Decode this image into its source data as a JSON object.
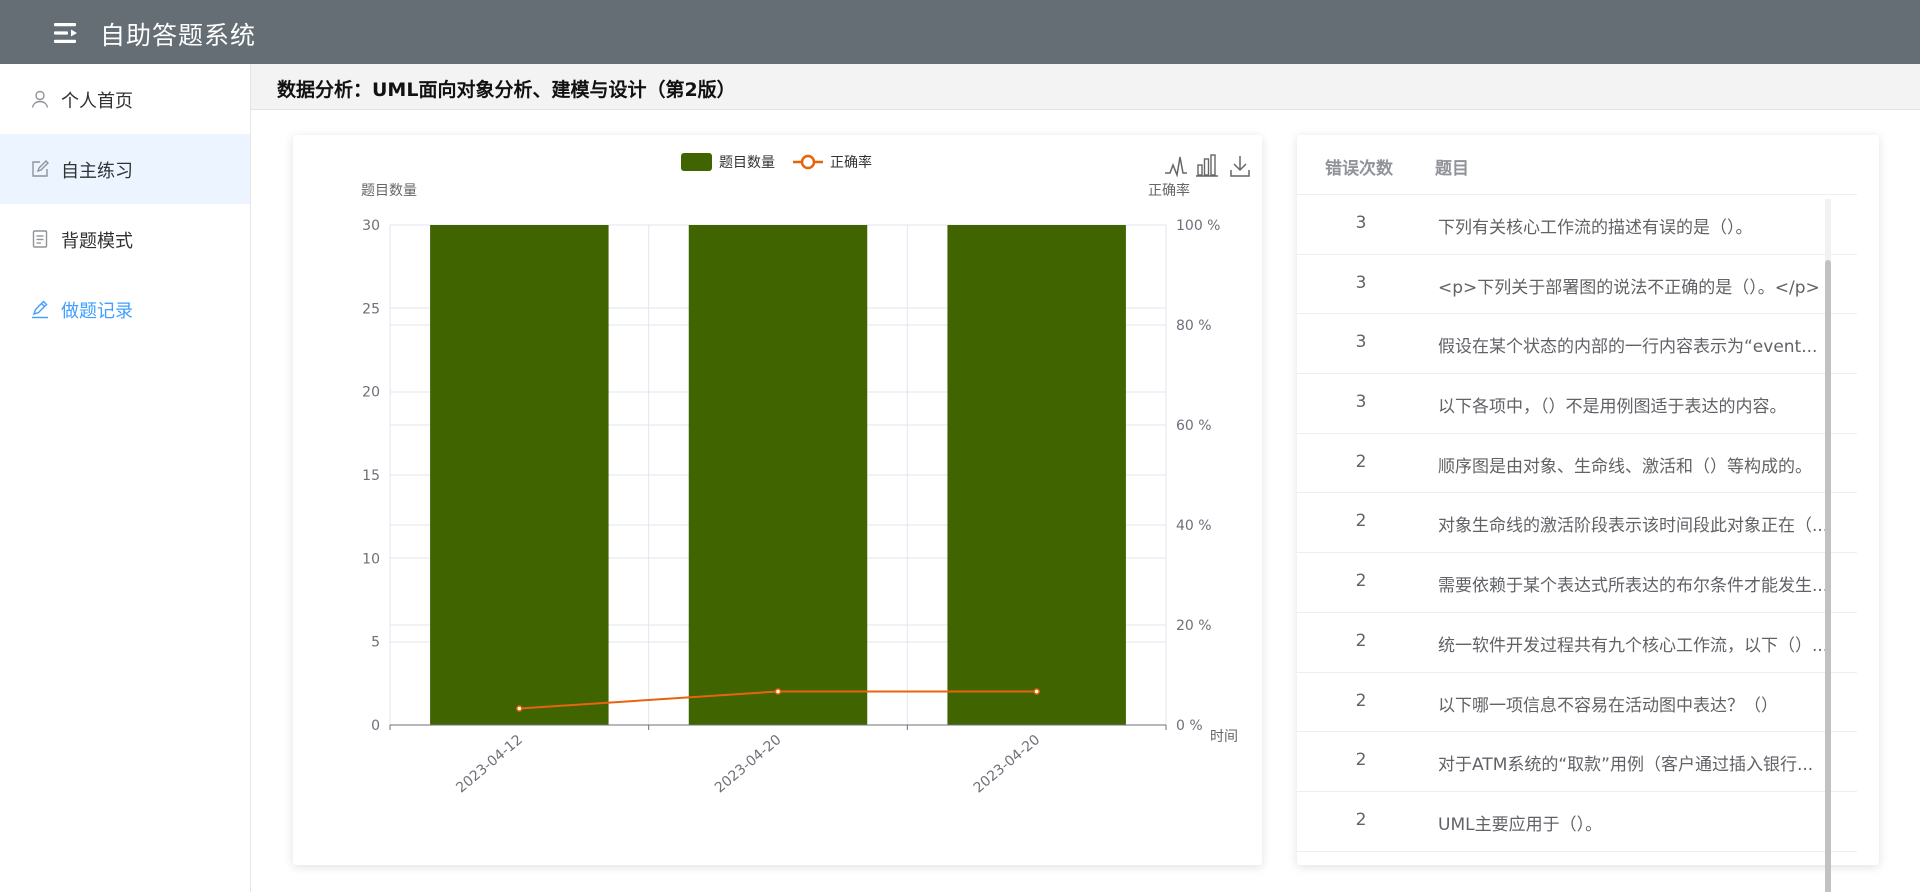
{
  "app": {
    "title": "自助答题系统"
  },
  "sidebar": {
    "items": [
      {
        "label": "个人首页",
        "icon": "user-icon"
      },
      {
        "label": "自主练习",
        "icon": "edit-icon"
      },
      {
        "label": "背题模式",
        "icon": "document-icon"
      },
      {
        "label": "做题记录",
        "icon": "pen-icon"
      }
    ]
  },
  "page": {
    "title": "数据分析：UML面向对象分析、建模与设计（第2版）"
  },
  "colors": {
    "bar": "#3f6400",
    "line": "#e8640a",
    "accent": "#409eff",
    "topbar": "#646e74"
  },
  "chart_data": {
    "type": "bar",
    "categories": [
      "2023-04-12",
      "2023-04-20",
      "2023-04-20"
    ],
    "series": [
      {
        "name": "题目数量",
        "type": "bar",
        "axis": "left",
        "values": [
          30,
          30,
          30
        ]
      },
      {
        "name": "正确率",
        "type": "line",
        "axis": "right",
        "values": [
          3.3,
          6.7,
          6.7
        ]
      }
    ],
    "ylabel": "题目数量",
    "y2label": "正确率",
    "xlabel": "时间",
    "ylim": [
      0,
      30
    ],
    "y2lim": [
      0,
      100
    ],
    "yticks": [
      "0",
      "5",
      "10",
      "15",
      "20",
      "25",
      "30"
    ],
    "y2ticks": [
      "0 %",
      "20 %",
      "40 %",
      "60 %",
      "80 %",
      "100 %"
    ],
    "legend": "top-center",
    "grid": true,
    "toolbox": [
      "line-chart-icon",
      "bar-chart-icon",
      "download-icon"
    ]
  },
  "table": {
    "headers": {
      "count": "错误次数",
      "question": "题目"
    },
    "rows": [
      {
        "count": "3",
        "question": "下列有关核心工作流的描述有误的是（）。"
      },
      {
        "count": "3",
        "question": "<p>下列关于部署图的说法不正确的是（）。</p>"
      },
      {
        "count": "3",
        "question": "假设在某个状态的内部的一行内容表示为“event..."
      },
      {
        "count": "3",
        "question": "以下各项中，（）不是用例图适于表达的内容。"
      },
      {
        "count": "2",
        "question": "顺序图是由对象、生命线、激活和（）等构成的。"
      },
      {
        "count": "2",
        "question": "对象生命线的激活阶段表示该时间段此对象正在（..."
      },
      {
        "count": "2",
        "question": "需要依赖于某个表达式所表达的布尔条件才能发生..."
      },
      {
        "count": "2",
        "question": "统一软件开发过程共有九个核心工作流，以下（）..."
      },
      {
        "count": "2",
        "question": "以下哪一项信息不容易在活动图中表达？（）"
      },
      {
        "count": "2",
        "question": "对于ATM系统的“取款”用例（客户通过插入银行..."
      },
      {
        "count": "2",
        "question": "UML主要应用于（）。"
      }
    ]
  }
}
